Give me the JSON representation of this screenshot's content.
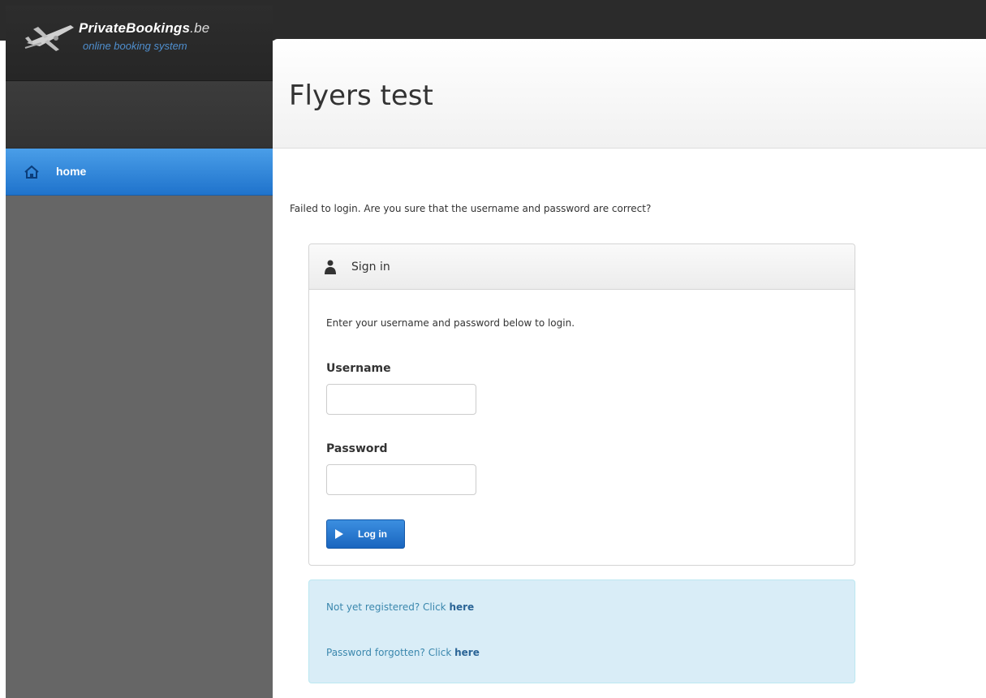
{
  "brand": {
    "name": "PrivateBookings",
    "tld": ".be",
    "tagline": "online booking system",
    "logo_icon": "airplane-icon"
  },
  "sidebar": {
    "items": [
      {
        "label": "home",
        "icon": "house-icon",
        "active": true
      }
    ]
  },
  "header": {
    "title": "Flyers test"
  },
  "alert": {
    "error": "Failed to login. Are you sure that the username and password are correct?"
  },
  "signin": {
    "title": "Sign in",
    "icon": "user-icon",
    "intro": "Enter your username and password below to login.",
    "username_label": "Username",
    "username_value": "",
    "password_label": "Password",
    "password_value": "",
    "login_label": "Log in",
    "login_icon": "play-icon"
  },
  "info": {
    "register_text": "Not yet registered? Click ",
    "register_link": "here",
    "forgot_text": "Password forgotten? Click ",
    "forgot_link": "here"
  },
  "colors": {
    "accent": "#1f73cc",
    "sidebar": "#666666",
    "topbar": "#2b2b2b",
    "info_bg": "#d9edf7"
  }
}
